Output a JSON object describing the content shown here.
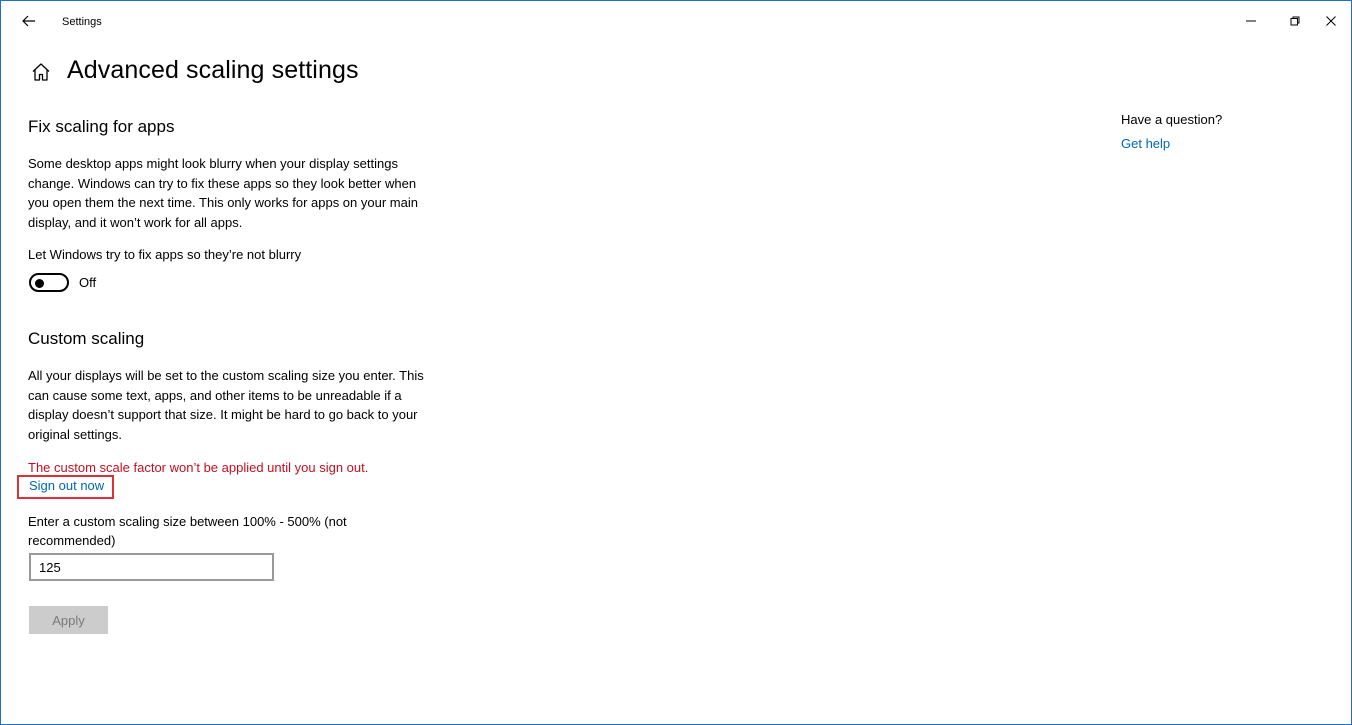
{
  "window": {
    "app_title": "Settings",
    "accent_color": "#1f6fc5"
  },
  "header": {
    "title": "Advanced scaling settings"
  },
  "fix_scaling": {
    "heading": "Fix scaling for apps",
    "description": "Some desktop apps might look blurry when your display settings change. Windows can try to fix these apps so they look better when you open them the next time. This only works for apps on your main display, and it won’t work for all apps.",
    "toggle_label": "Let Windows try to fix apps so they’re not blurry",
    "toggle_state": "Off"
  },
  "custom_scaling": {
    "heading": "Custom scaling",
    "description": "All your displays will be set to the custom scaling size you enter. This can cause some text, apps, and other items to be unreadable if a display doesn’t support that size. It might be hard to go back to your original settings.",
    "warning": "The custom scale factor won’t be applied until you sign out.",
    "warning_color": "#c50f1f",
    "sign_out_link": "Sign out now",
    "input_label": "Enter a custom scaling size between 100% - 500% (not recommended)",
    "input_value": "125",
    "apply_label": "Apply"
  },
  "sidebar": {
    "question": "Have a question?",
    "help_link": "Get help",
    "link_color": "#0067b8"
  }
}
